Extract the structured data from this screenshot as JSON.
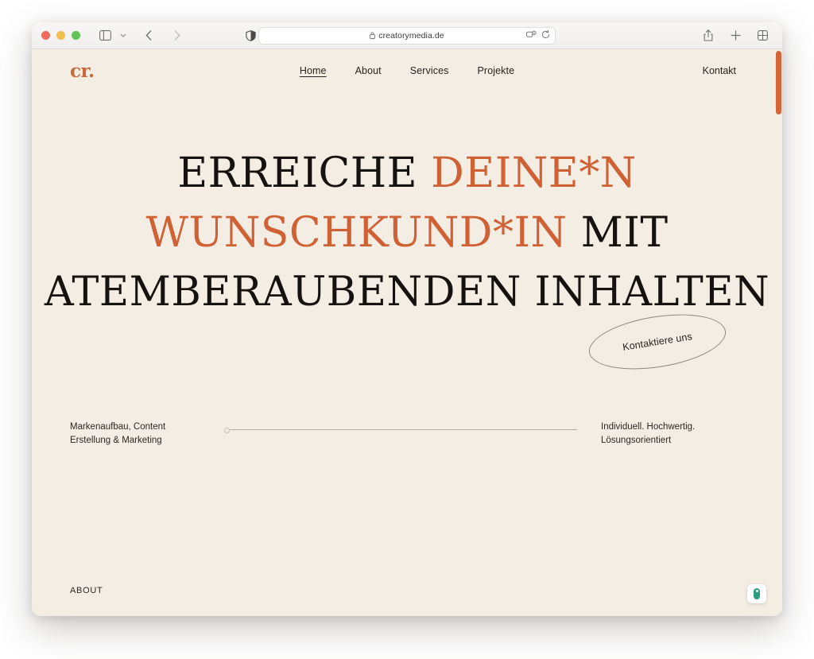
{
  "browser": {
    "traffic_lights": [
      "close",
      "minimize",
      "zoom"
    ],
    "sidebar_button": "sidebar-icon",
    "tab_group_chevron": "chevron-down-icon",
    "back_label": "back-icon",
    "forward_label": "forward-icon",
    "reader_label": "reader-mode-icon",
    "address": {
      "lock": "lock-icon",
      "url": "creatorymedia.de",
      "extensions_icon": "extensions-icon",
      "reload_icon": "reload-icon"
    },
    "right_tools": [
      {
        "name": "share-button",
        "icon": "share-icon"
      },
      {
        "name": "new-tab-button",
        "icon": "plus-icon"
      },
      {
        "name": "tab-overview-button",
        "icon": "grid-icon"
      }
    ]
  },
  "site": {
    "logo": "cr.",
    "nav": [
      {
        "label": "Home",
        "active": true
      },
      {
        "label": "About",
        "active": false
      },
      {
        "label": "Services",
        "active": false
      },
      {
        "label": "Projekte",
        "active": false
      }
    ],
    "contact": "Kontakt",
    "headline": {
      "line1_dark": "ERREICHE",
      "line1_accent": "DEINE*N",
      "line2_accent": "WUNSCHKUND*IN",
      "line2_dark": "MIT",
      "line3": "ATEMBERAUBENDEN  INHALTEN"
    },
    "badge": "Kontaktiere uns",
    "sub_left": "Markenaufbau, Content\nErstellung & Marketing",
    "sub_right": "Individuell. Hochwertig.\nLösungsorientiert",
    "footer_label": "ABOUT",
    "consent_badge": "privacy-consent-icon",
    "colors": {
      "background": "#f4ede3",
      "accent": "#cf6134",
      "text": "#16120f",
      "scrollbar": "#d4673a",
      "consent_green": "#2e9d7e"
    }
  }
}
